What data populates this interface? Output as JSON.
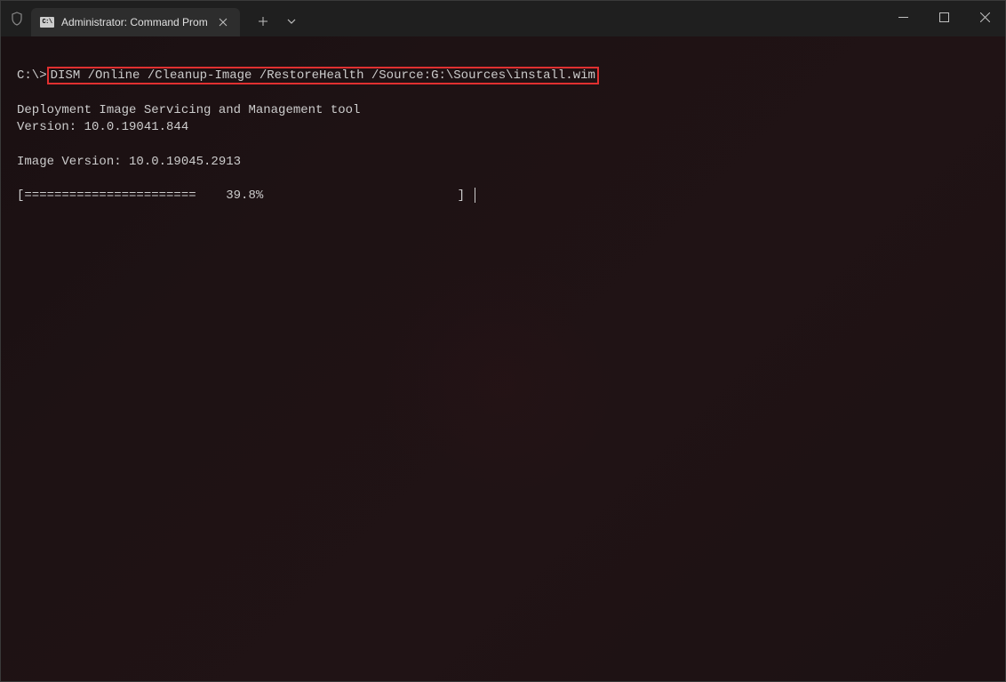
{
  "titlebar": {
    "tab_icon_label": "C:\\",
    "tab_title": "Administrator: Command Prom"
  },
  "terminal": {
    "prompt": "C:\\>",
    "command": "DISM /Online /Cleanup-Image /RestoreHealth /Source:G:\\Sources\\install.wim",
    "tool_line": "Deployment Image Servicing and Management tool",
    "version_line": "Version: 10.0.19041.844",
    "image_version_line": "Image Version: 10.0.19045.2913",
    "progress_text": "[=======================    39.8%                          ] "
  }
}
